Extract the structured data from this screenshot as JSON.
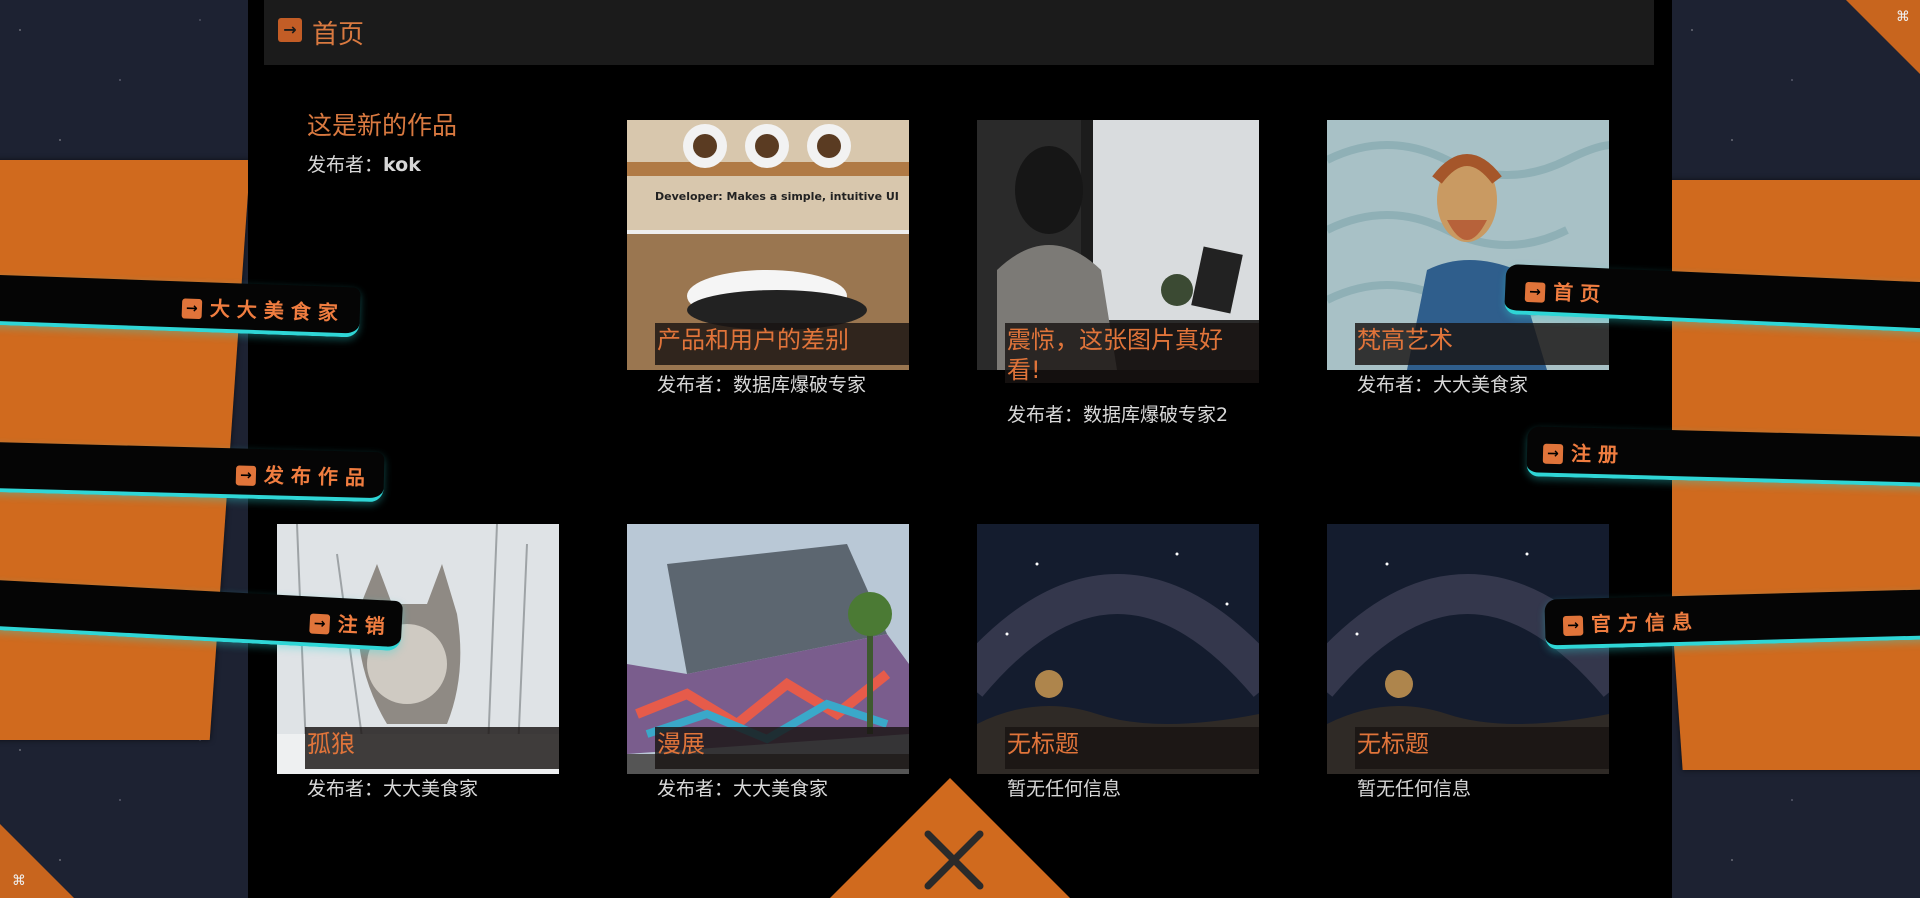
{
  "header": {
    "icon": "arrow-right-square-icon",
    "title": "首页"
  },
  "feature": {
    "title": "这是新的作品",
    "publisher_label": "发布者：",
    "publisher": "kok"
  },
  "cards": [
    {
      "title": "产品和用户的差别",
      "publisher_label": "发布者：",
      "publisher": "数据库爆破专家",
      "image_text": "Developer:  Makes a simple, intuitive UI"
    },
    {
      "title": "震惊，这张图片真好看!",
      "publisher_label": "发布者：",
      "publisher": "数据库爆破专家2"
    },
    {
      "title": "梵高艺术",
      "publisher_label": "发布者：",
      "publisher": "大大美食家"
    },
    {
      "title": "孤狼",
      "publisher_label": "发布者：",
      "publisher": "大大美食家"
    },
    {
      "title": "漫展",
      "publisher_label": "发布者：",
      "publisher": "大大美食家"
    },
    {
      "title": "无标题",
      "info": "暂无任何信息"
    },
    {
      "title": "无标题",
      "info": "暂无任何信息"
    }
  ],
  "nav": {
    "left": [
      {
        "label": "大大美食家",
        "icon": "arrow-right-square-icon"
      },
      {
        "label": "发布作品",
        "icon": "arrow-right-square-icon"
      },
      {
        "label": "注销",
        "icon": "arrow-right-square-icon"
      }
    ],
    "right": [
      {
        "label": "首页",
        "icon": "arrow-right-square-icon"
      },
      {
        "label": "注册",
        "icon": "arrow-right-square-icon"
      },
      {
        "label": "官方信息",
        "icon": "arrow-right-square-icon"
      }
    ]
  },
  "close_button": {
    "icon": "close-icon"
  },
  "colors": {
    "accent": "#d06a1e",
    "title_orange": "#e0743a",
    "neon": "#2fd6d6",
    "header_bg": "#1b1b1b"
  }
}
